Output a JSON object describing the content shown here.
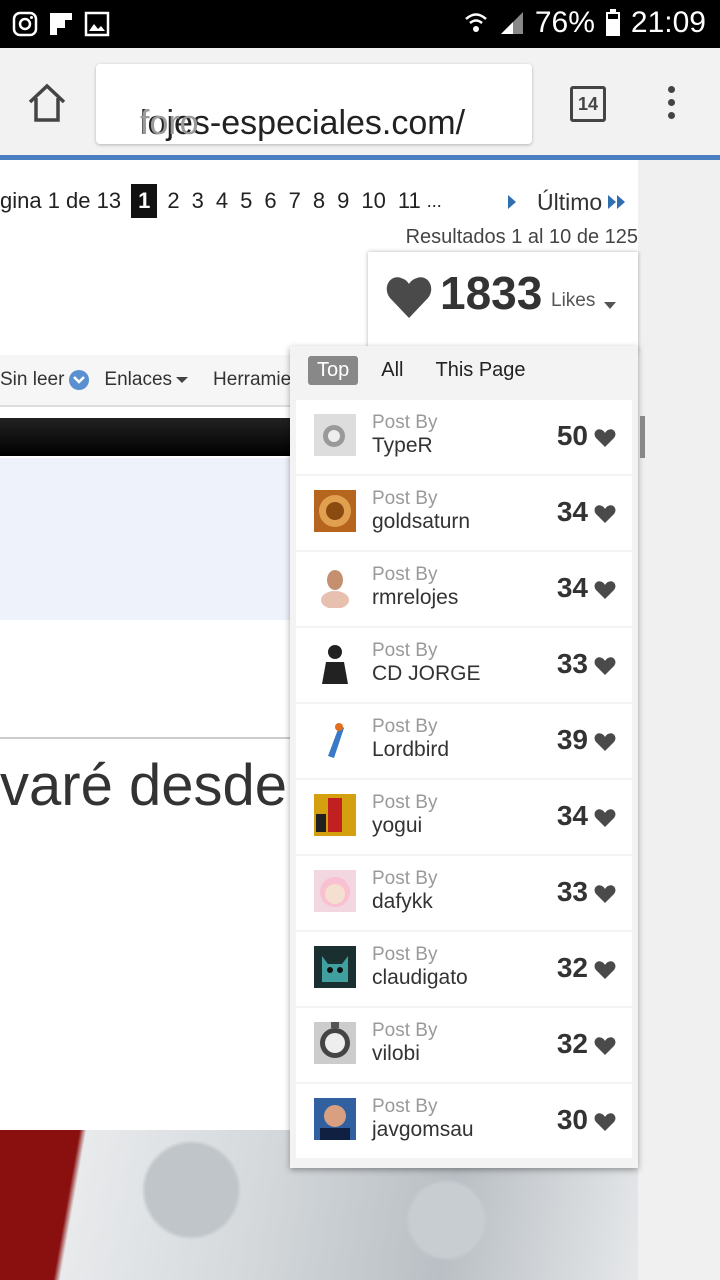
{
  "status_bar": {
    "battery": "76%",
    "time": "21:09"
  },
  "browser": {
    "url_main": "lojes-especiales.com/",
    "url_rest": "foro",
    "tab_count": "14"
  },
  "pagination": {
    "label": "gina 1 de 13",
    "current": "1",
    "pages": [
      "2",
      "3",
      "4",
      "5",
      "6",
      "7",
      "8",
      "9",
      "10",
      "11"
    ],
    "ellipsis": "...",
    "last_label": "Último",
    "results": "Resultados 1 al 10 de 125"
  },
  "toolbar": {
    "unread": "Sin leer",
    "links": "Enlaces",
    "tools": "Herramie"
  },
  "title_fragment": "varé desde",
  "likes": {
    "count": "1833",
    "label": "Likes",
    "tabs": {
      "top": "Top",
      "all": "All",
      "this_page": "This Page"
    },
    "posts": [
      {
        "prefix": "Post By",
        "user": "TypeR",
        "score": "50"
      },
      {
        "prefix": "Post By",
        "user": "goldsaturn",
        "score": "34"
      },
      {
        "prefix": "Post By",
        "user": "rmrelojes",
        "score": "34"
      },
      {
        "prefix": "Post By",
        "user": "CD JORGE",
        "score": "33"
      },
      {
        "prefix": "Post By",
        "user": "Lordbird",
        "score": "39"
      },
      {
        "prefix": "Post By",
        "user": "yogui",
        "score": "34"
      },
      {
        "prefix": "Post By",
        "user": "dafykk",
        "score": "33"
      },
      {
        "prefix": "Post By",
        "user": "claudigato",
        "score": "32"
      },
      {
        "prefix": "Post By",
        "user": "vilobi",
        "score": "32"
      },
      {
        "prefix": "Post By",
        "user": "javgomsau",
        "score": "30"
      }
    ]
  },
  "colors": {
    "accent": "#4a7fc1",
    "heart": "#4a4a4a"
  }
}
